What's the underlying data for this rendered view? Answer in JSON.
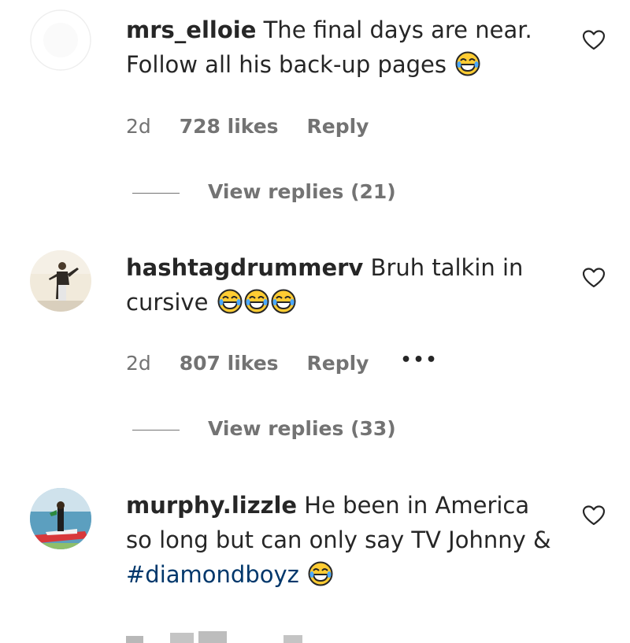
{
  "comments": [
    {
      "username": "mrs_elloie",
      "text": "The final days are near. Follow all his back-up pages",
      "emojis": [
        "😂"
      ],
      "age": "2d",
      "likes": "728 likes",
      "reply": "Reply",
      "view_replies": "View replies (21)"
    },
    {
      "username": "hashtagdrummerv",
      "text": "Bruh talkin in cursive",
      "emojis": [
        "😂",
        "😂",
        "😂"
      ],
      "age": "2d",
      "likes": "807 likes",
      "reply": "Reply",
      "more": "•••",
      "view_replies": "View replies (33)"
    },
    {
      "username": "murphy.lizzle",
      "text_before_hashtag": "He been in America so long but can only say TV Johnny &",
      "hashtag": "#diamondboyz",
      "emojis": [
        "😂"
      ]
    }
  ],
  "icons": {
    "like": "heart-outline-icon",
    "emoji": "face-with-tears-of-joy-emoji"
  },
  "colors": {
    "text": "#262626",
    "secondary": "#737373",
    "hashtag": "#00376b",
    "emoji_face": "#ffcc33"
  }
}
